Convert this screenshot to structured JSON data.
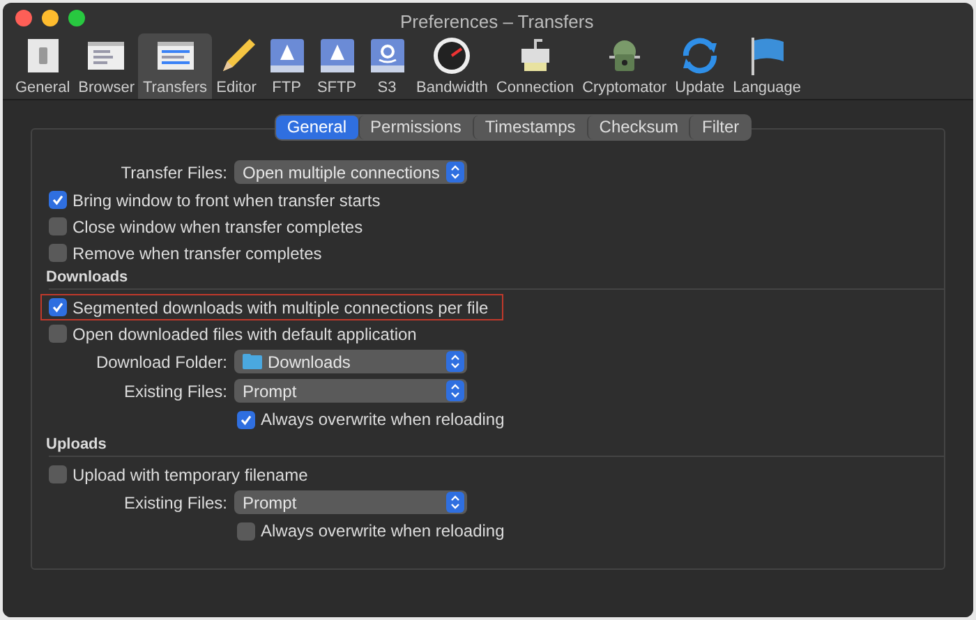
{
  "window": {
    "title": "Preferences – Transfers"
  },
  "toolbar": [
    {
      "label": "General",
      "kind": "switch",
      "selected": false
    },
    {
      "label": "Browser",
      "kind": "browser",
      "selected": false
    },
    {
      "label": "Transfers",
      "kind": "transfers",
      "selected": true
    },
    {
      "label": "Editor",
      "kind": "pencil",
      "selected": false
    },
    {
      "label": "FTP",
      "kind": "drive",
      "selected": false
    },
    {
      "label": "SFTP",
      "kind": "drive",
      "selected": false
    },
    {
      "label": "S3",
      "kind": "s3",
      "selected": false
    },
    {
      "label": "Bandwidth",
      "kind": "gauge",
      "selected": false
    },
    {
      "label": "Connection",
      "kind": "plug",
      "selected": false
    },
    {
      "label": "Cryptomator",
      "kind": "robot",
      "selected": false
    },
    {
      "label": "Update",
      "kind": "sync",
      "selected": false
    },
    {
      "label": "Language",
      "kind": "flag",
      "selected": false
    }
  ],
  "tabs": [
    {
      "label": "General",
      "selected": true
    },
    {
      "label": "Permissions",
      "selected": false
    },
    {
      "label": "Timestamps",
      "selected": false
    },
    {
      "label": "Checksum",
      "selected": false
    },
    {
      "label": "Filter",
      "selected": false
    }
  ],
  "rows": [
    {
      "kind": "select",
      "label": "Transfer Files:",
      "value": "Open multiple connections"
    },
    {
      "kind": "checkbox",
      "label": "Bring window to front when transfer starts",
      "checked": true,
      "highlighted": false
    },
    {
      "kind": "checkbox",
      "label": "Close window when transfer completes",
      "checked": false,
      "highlighted": false
    },
    {
      "kind": "checkbox",
      "label": "Remove when transfer completes",
      "checked": false,
      "highlighted": false
    },
    {
      "kind": "section",
      "label": "Downloads"
    },
    {
      "kind": "checkbox",
      "label": "Segmented downloads with multiple connections per file",
      "checked": true,
      "highlighted": true
    },
    {
      "kind": "checkbox",
      "label": "Open downloaded files with default application",
      "checked": false,
      "highlighted": false
    },
    {
      "kind": "select",
      "label": "Download Folder:",
      "value": "Downloads",
      "folder": true
    },
    {
      "kind": "select",
      "label": "Existing Files:",
      "value": "Prompt"
    },
    {
      "kind": "subcheckbox",
      "label": "Always overwrite when reloading",
      "checked": true
    },
    {
      "kind": "section",
      "label": "Uploads"
    },
    {
      "kind": "checkbox",
      "label": "Upload with temporary filename",
      "checked": false,
      "highlighted": false
    },
    {
      "kind": "select",
      "label": "Existing Files:",
      "value": "Prompt"
    },
    {
      "kind": "subcheckbox",
      "label": "Always overwrite when reloading",
      "checked": false
    }
  ]
}
